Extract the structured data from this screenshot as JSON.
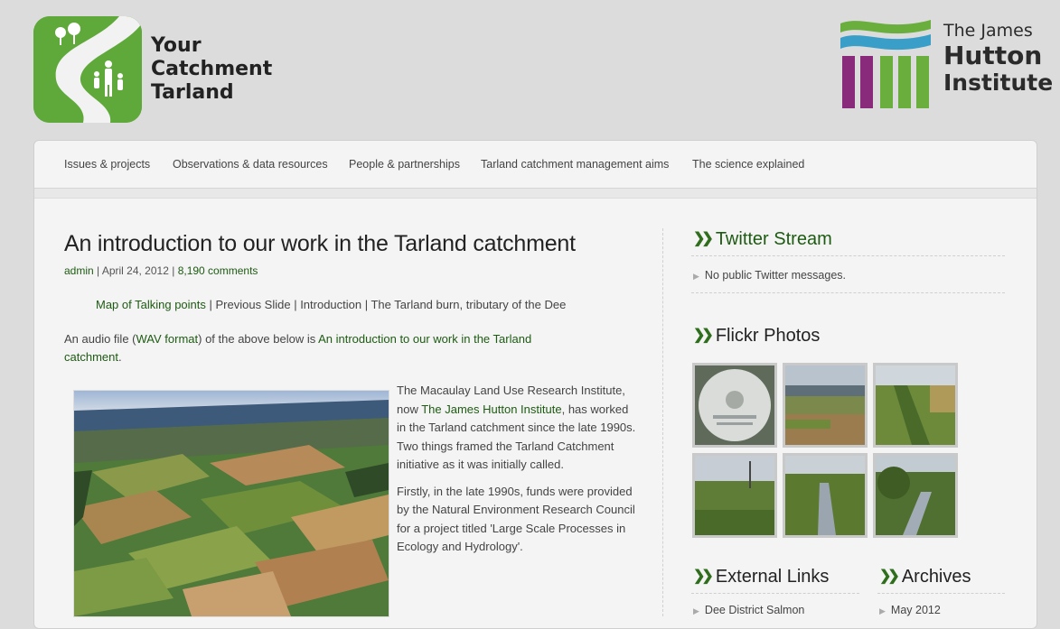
{
  "header": {
    "site_title_lines": [
      "Your",
      "Catchment",
      "Tarland"
    ],
    "partner_lines": [
      "The James",
      "Hutton",
      "Institute"
    ]
  },
  "nav": {
    "items": [
      "Issues & projects",
      "Observations & data resources",
      "People & partnerships",
      "Tarland catchment management aims",
      "The science explained"
    ]
  },
  "post": {
    "title": "An introduction to our work in the Tarland catchment",
    "author": "admin",
    "date": "April 24, 2012",
    "comments": "8,190 comments",
    "talking_points": {
      "link": "Map of Talking points",
      "rest": " | Previous Slide | Introduction | The Tarland burn, tributary of the Dee"
    },
    "audio": {
      "pre": "An audio file (",
      "format_link": "WAV format",
      "mid": ") of the above below is ",
      "title_link": "An introduction to our work in the Tarland catchment",
      "post": "."
    },
    "para1": {
      "pre": "The Macaulay Land Use Research Institute, now ",
      "link": "The James Hutton Institute",
      "post": ", has worked in the Tarland catchment since the late 1990s. Two things framed the Tarland Catchment initiative as it was initially called."
    },
    "para2": "Firstly, in the late 1990s, funds were provided by the Natural Environment Research Council for a project titled 'Large Scale Processes in Ecology and Hydrology'."
  },
  "sidebar": {
    "twitter": {
      "title": "Twitter Stream",
      "message": "No public Twitter messages."
    },
    "flickr": {
      "title": "Flickr Photos"
    },
    "external": {
      "title": "External Links",
      "first_item": "Dee District Salmon"
    },
    "archives": {
      "title": "Archives",
      "first_item": "May 2012"
    }
  },
  "colors": {
    "link_green": "#1d5b12",
    "logo_green": "#5fa83a",
    "hutton_purple": "#8a2a7a",
    "hutton_blue": "#3a9fc8"
  }
}
